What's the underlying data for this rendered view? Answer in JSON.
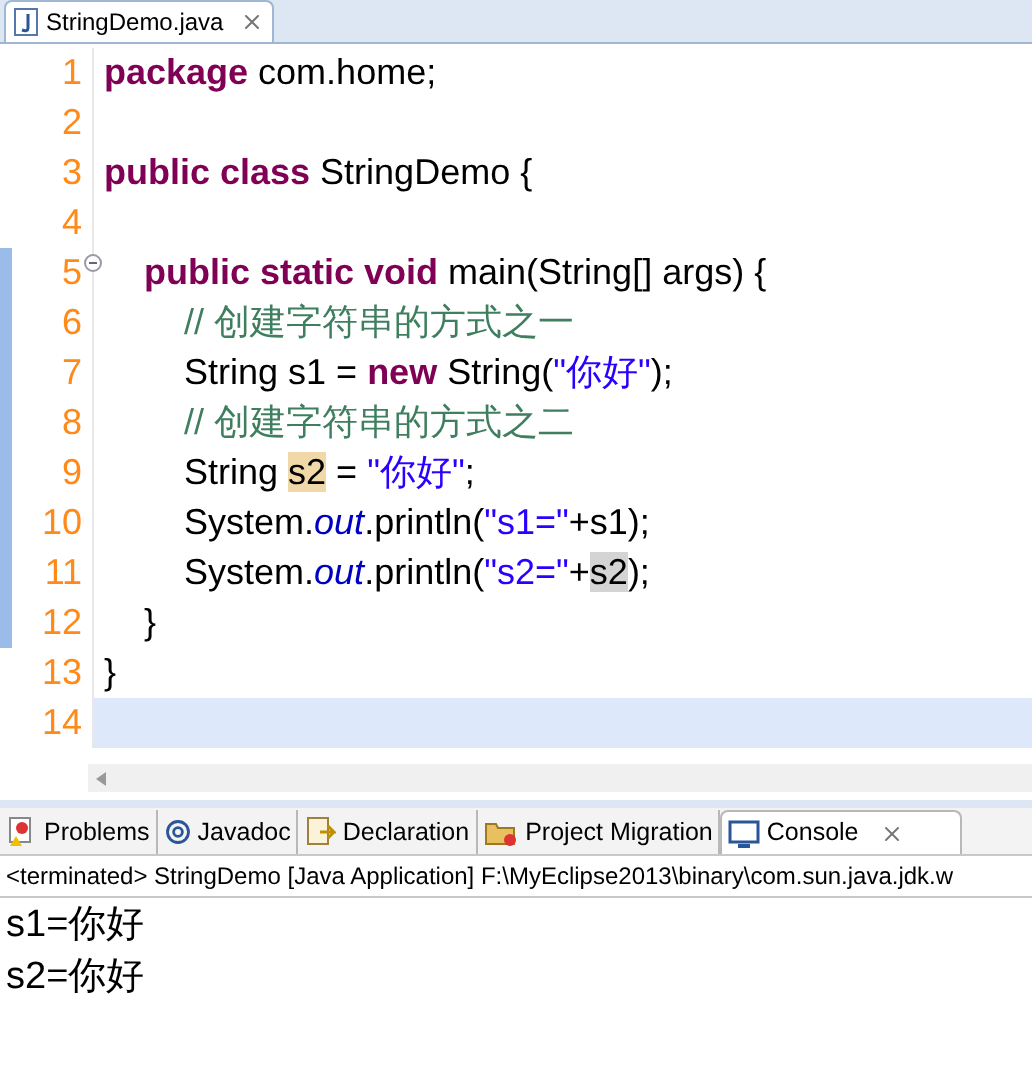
{
  "editor_tab": {
    "title": "StringDemo.java",
    "selected": true
  },
  "code_lines": [
    {
      "number": "1",
      "current": false,
      "in_range": false,
      "fold_marker": false,
      "tokens": [
        {
          "kind": "keyword",
          "text": "package"
        },
        {
          "kind": "plain",
          "text": " com.home;"
        }
      ]
    },
    {
      "number": "2",
      "current": false,
      "in_range": false,
      "fold_marker": false
    },
    {
      "number": "3",
      "current": false,
      "in_range": false,
      "fold_marker": false,
      "tokens": [
        {
          "kind": "keyword",
          "text": "public class"
        },
        {
          "kind": "plain",
          "text": " StringDemo {"
        }
      ]
    },
    {
      "number": "4",
      "current": false,
      "in_range": false,
      "fold_marker": false
    },
    {
      "number": "5",
      "current": false,
      "in_range": true,
      "fold_marker": true,
      "tokens": [
        {
          "kind": "keyword",
          "text": "    public static void"
        },
        {
          "kind": "plain",
          "text": " main(String[] args) {"
        }
      ]
    },
    {
      "number": "6",
      "current": false,
      "in_range": true,
      "fold_marker": false,
      "tokens": [
        {
          "kind": "comment",
          "text": "        // 创建字符串的方式之一"
        }
      ]
    },
    {
      "number": "7",
      "current": false,
      "in_range": true,
      "fold_marker": false,
      "tokens": [
        {
          "kind": "plain",
          "text": "        String s1 = "
        },
        {
          "kind": "keyword",
          "text": "new"
        },
        {
          "kind": "plain",
          "text": " String("
        },
        {
          "kind": "string",
          "text": "\"你好\""
        },
        {
          "kind": "plain",
          "text": ");"
        }
      ]
    },
    {
      "number": "8",
      "current": false,
      "in_range": true,
      "fold_marker": false,
      "tokens": [
        {
          "kind": "comment",
          "text": "        // 创建字符串的方式之二"
        }
      ]
    },
    {
      "number": "9",
      "current": false,
      "in_range": true,
      "fold_marker": false,
      "tokens": [
        {
          "kind": "plain",
          "text": "        String "
        },
        {
          "kind": "occurrence",
          "text": "s2"
        },
        {
          "kind": "plain",
          "text": " = "
        },
        {
          "kind": "string",
          "text": "\"你好\""
        },
        {
          "kind": "plain",
          "text": ";"
        }
      ]
    },
    {
      "number": "10",
      "current": false,
      "in_range": true,
      "fold_marker": false,
      "tokens": [
        {
          "kind": "plain",
          "text": "        System."
        },
        {
          "kind": "field",
          "text": "out"
        },
        {
          "kind": "plain",
          "text": ".println("
        },
        {
          "kind": "string",
          "text": "\"s1=\""
        },
        {
          "kind": "plain",
          "text": "+s1);"
        }
      ]
    },
    {
      "number": "11",
      "current": false,
      "in_range": true,
      "fold_marker": false,
      "tokens": [
        {
          "kind": "plain",
          "text": "        System."
        },
        {
          "kind": "field",
          "text": "out"
        },
        {
          "kind": "plain",
          "text": ".println("
        },
        {
          "kind": "string",
          "text": "\"s2=\""
        },
        {
          "kind": "plain",
          "text": "+"
        },
        {
          "kind": "reference",
          "text": "s2"
        },
        {
          "kind": "plain",
          "text": ");"
        }
      ]
    },
    {
      "number": "12",
      "current": false,
      "in_range": true,
      "fold_marker": false,
      "tokens": [
        {
          "kind": "plain",
          "text": "    }"
        }
      ]
    },
    {
      "number": "13",
      "current": false,
      "in_range": false,
      "fold_marker": false,
      "tokens": [
        {
          "kind": "plain",
          "text": "}"
        }
      ]
    },
    {
      "number": "14",
      "current": true,
      "in_range": false,
      "fold_marker": false
    }
  ],
  "view_tabs": [
    {
      "kind": "problems",
      "label": "Problems",
      "selected": false
    },
    {
      "kind": "javadoc",
      "label": "Javadoc",
      "selected": false
    },
    {
      "kind": "declaration",
      "label": "Declaration",
      "selected": false
    },
    {
      "kind": "migration",
      "label": "Project Migration",
      "selected": false
    },
    {
      "kind": "console",
      "label": "Console",
      "selected": true
    }
  ],
  "console": {
    "header": "<terminated> StringDemo [Java Application] F:\\MyEclipse2013\\binary\\com.sun.java.jdk.w",
    "output": [
      "s1=你好",
      "s2=你好"
    ]
  }
}
